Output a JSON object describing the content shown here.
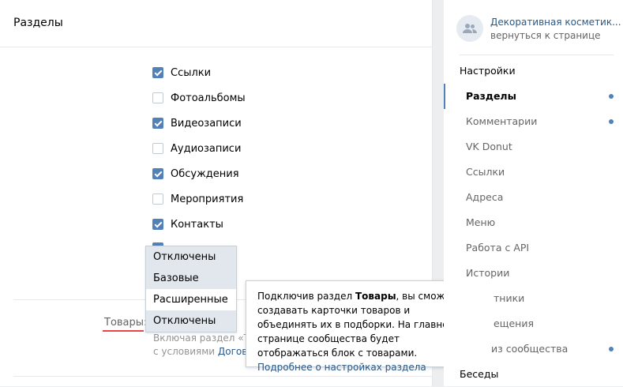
{
  "main": {
    "title": "Разделы",
    "checkboxes": [
      {
        "label": "Ссылки",
        "checked": true
      },
      {
        "label": "Фотоальбомы",
        "checked": false
      },
      {
        "label": "Видеозаписи",
        "checked": true
      },
      {
        "label": "Аудиозаписи",
        "checked": false
      },
      {
        "label": "Обсуждения",
        "checked": true
      },
      {
        "label": "Мероприятия",
        "checked": false
      },
      {
        "label": "Контакты",
        "checked": true
      }
    ],
    "goods": {
      "label": "Товары:",
      "desc_line1": "Включая раздел «То",
      "desc_line2_prefix": "с условиями",
      "desc_line2_link": "Догово"
    },
    "dropdown": {
      "options": [
        "Отключены",
        "Базовые",
        "Расширенные",
        "Отключены"
      ],
      "highlighted_index": 1
    }
  },
  "tooltip": {
    "part1": "Подключив раздел ",
    "bold": "Товары",
    "part2": ", вы сможете создавать карточки товаров и объединять их в подборки. На главной странице сообщества будет отображаться блок с товарами.",
    "link": "Подробнее о настройках раздела"
  },
  "sidebar": {
    "group_name": "Декоративная косметик...",
    "back_link": "вернуться к странице",
    "items": [
      {
        "label": "Настройки",
        "type": "top"
      },
      {
        "label": "Разделы",
        "type": "sub",
        "active": true,
        "dot": true
      },
      {
        "label": "Комментарии",
        "type": "sub",
        "dot": true
      },
      {
        "label": "VK Donut",
        "type": "sub"
      },
      {
        "label": "Ссылки",
        "type": "sub"
      },
      {
        "label": "Адреса",
        "type": "sub"
      },
      {
        "label": "Меню",
        "type": "sub"
      },
      {
        "label": "Работа с API",
        "type": "sub"
      },
      {
        "label": "Истории",
        "type": "sub"
      },
      {
        "label": "тники",
        "type": "sub"
      },
      {
        "label": "ещения",
        "type": "sub"
      },
      {
        "label": "из сообщества",
        "type": "sub",
        "dot": true
      },
      {
        "label": "Беседы",
        "type": "top"
      }
    ]
  },
  "colors": {
    "accent": "#5181b8",
    "link": "#2a5885",
    "warning_underline": "#e64646"
  }
}
